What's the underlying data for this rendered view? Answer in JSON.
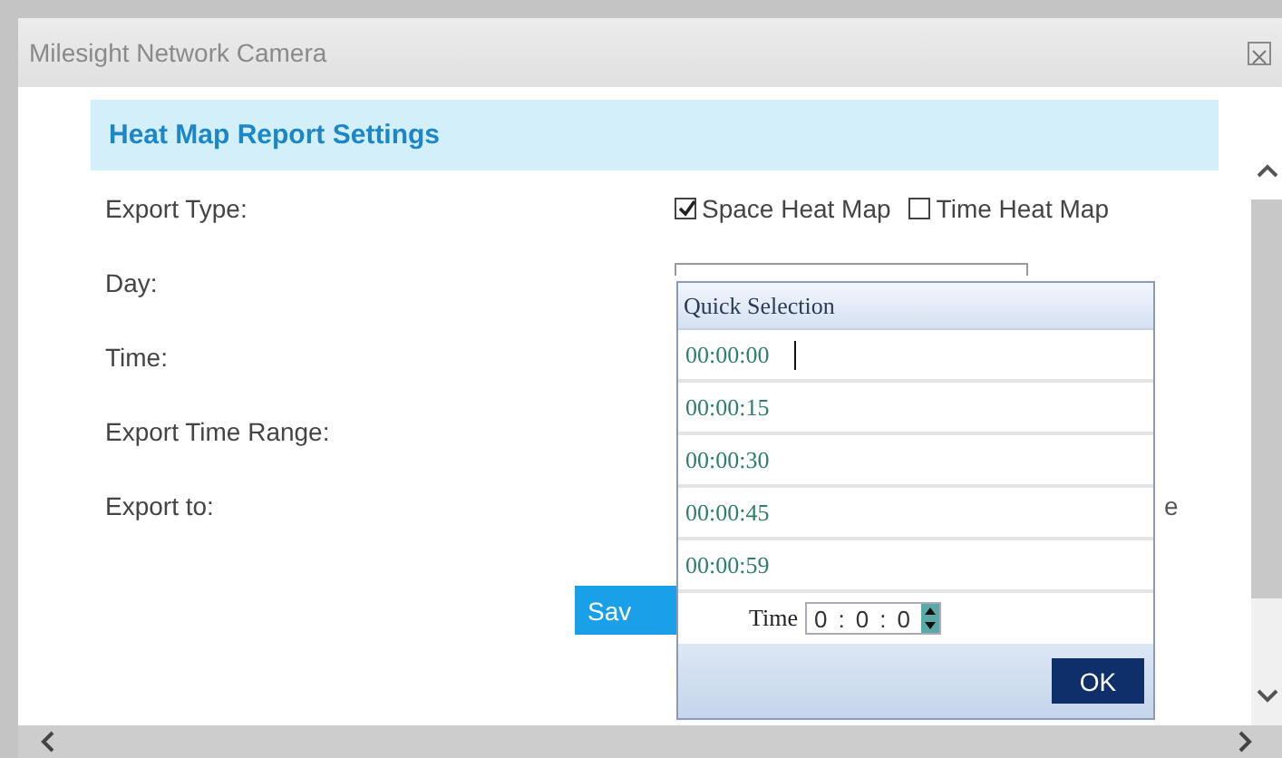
{
  "window": {
    "title": "Milesight Network Camera"
  },
  "section": {
    "title": "Heat Map Report Settings"
  },
  "fields": [
    {
      "label": "Export Type:",
      "kind": "checkboxes",
      "options": [
        {
          "label": "Space Heat Map",
          "checked": true
        },
        {
          "label": "Time Heat Map",
          "checked": false
        }
      ]
    },
    {
      "label": "Day:",
      "kind": "select"
    },
    {
      "label": "Time:",
      "kind": "blank"
    },
    {
      "label": "Export Time Range:",
      "kind": "blank"
    },
    {
      "label": "Export to:",
      "kind": "fragment",
      "text": "e"
    }
  ],
  "save_button": {
    "label": "Sav"
  },
  "quick_selection": {
    "title": "Quick Selection",
    "options": [
      {
        "label": "00:00:00"
      },
      {
        "label": "00:00:15"
      },
      {
        "label": "00:00:30"
      },
      {
        "label": "00:00:45"
      },
      {
        "label": "00:00:59"
      }
    ],
    "time_label": "Time",
    "time_parts": [
      "0",
      "0",
      "0"
    ],
    "separator": ":",
    "ok_button": "OK"
  }
}
